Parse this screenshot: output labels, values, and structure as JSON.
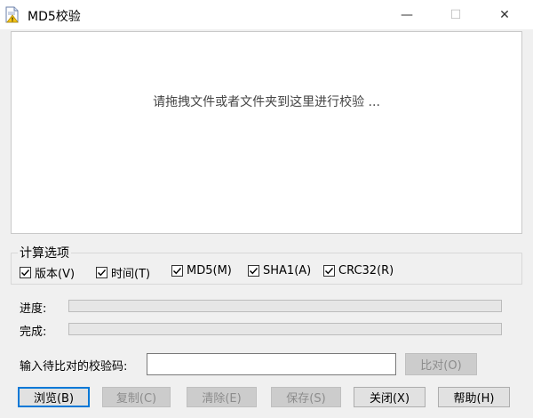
{
  "window": {
    "title": "MD5校验",
    "minimize_glyph": "—",
    "maximize_glyph": "☐",
    "close_glyph": "✕",
    "icon": "document-warning-icon"
  },
  "drop_area": {
    "hint": "请拖拽文件或者文件夹到这里进行校验 ..."
  },
  "options": {
    "group_title": "计算选项",
    "items": [
      {
        "label": "版本(V)",
        "checked": true
      },
      {
        "label": "时间(T)",
        "checked": true
      },
      {
        "label": "MD5(M)",
        "checked": true
      },
      {
        "label": "SHA1(A)",
        "checked": true
      },
      {
        "label": "CRC32(R)",
        "checked": true
      }
    ]
  },
  "progress": {
    "label": "进度:",
    "value": 0
  },
  "complete": {
    "label": "完成:",
    "value": 0
  },
  "compare": {
    "label": "输入待比对的校验码:",
    "value": "",
    "button": "比对(O)"
  },
  "buttons": {
    "browse": "浏览(B)",
    "copy": "复制(C)",
    "clear": "清除(E)",
    "save": "保存(S)",
    "close": "关闭(X)",
    "help": "帮助(H)"
  },
  "colors": {
    "accent": "#0078d7",
    "progress_fill": "#06b025"
  }
}
